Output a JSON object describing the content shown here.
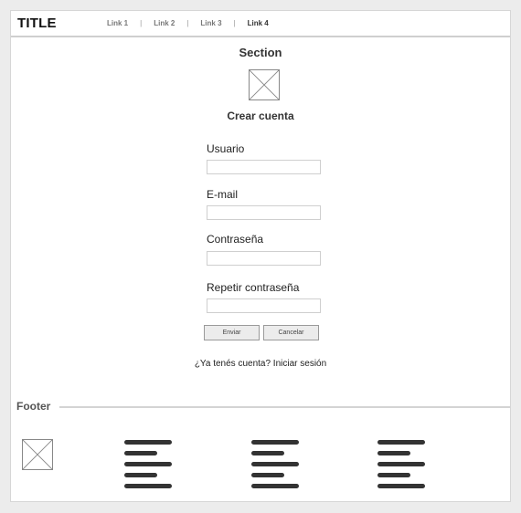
{
  "header": {
    "title": "TITLE",
    "nav": [
      {
        "label": "Link 1",
        "active": false
      },
      {
        "label": "Link 2",
        "active": false
      },
      {
        "label": "Link 3",
        "active": false
      },
      {
        "label": "Link 4",
        "active": true
      }
    ],
    "separator": "|"
  },
  "main": {
    "section_title": "Section",
    "image_icon": "image-placeholder-icon",
    "form": {
      "title": "Crear cuenta",
      "fields": [
        {
          "label": "Usuario",
          "value": "",
          "placeholder": ""
        },
        {
          "label": "E-mail",
          "value": "",
          "placeholder": ""
        },
        {
          "label": "Contraseña",
          "value": "",
          "placeholder": ""
        },
        {
          "label": "Repetir contraseña",
          "value": "",
          "placeholder": ""
        }
      ],
      "submit_label": "Enviar",
      "cancel_label": "Cancelar",
      "login_prompt": "¿Ya tenés cuenta? Iniciar sesión"
    }
  },
  "footer": {
    "title": "Footer",
    "image_icon": "image-placeholder-icon",
    "text_blocks": 3
  },
  "colors": {
    "background": "#ececec",
    "panel": "#ffffff",
    "text_placeholder": "#333333",
    "button": "#ececec"
  }
}
